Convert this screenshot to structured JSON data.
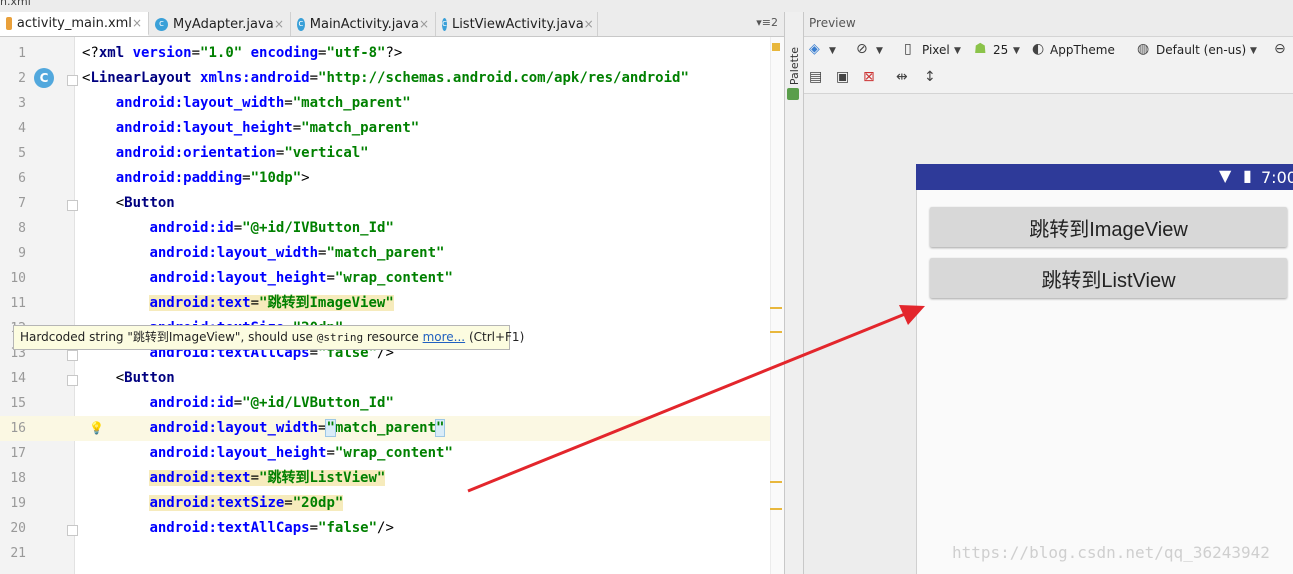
{
  "window": {
    "partial_title": "n.xml"
  },
  "tabs": [
    {
      "label": "activity_main.xml",
      "icon": "xml-file-icon",
      "active": true
    },
    {
      "label": "MyAdapter.java",
      "icon": "java-class-icon",
      "active": false
    },
    {
      "label": "MainActivity.java",
      "icon": "java-class-icon",
      "active": false
    },
    {
      "label": "ListViewActivity.java",
      "icon": "java-class-icon",
      "active": false
    }
  ],
  "tabs_overflow": "▾≡2",
  "editor": {
    "lines": [
      {
        "n": "1",
        "text": "<?xml version=\"1.0\" encoding=\"utf-8\"?>"
      },
      {
        "n": "2",
        "text": "<LinearLayout xmlns:android=\"http://schemas.android.com/apk/res/android\""
      },
      {
        "n": "3",
        "text": "    android:layout_width=\"match_parent\""
      },
      {
        "n": "4",
        "text": "    android:layout_height=\"match_parent\""
      },
      {
        "n": "5",
        "text": "    android:orientation=\"vertical\""
      },
      {
        "n": "6",
        "text": "    android:padding=\"10dp\">"
      },
      {
        "n": "7",
        "text": "    <Button"
      },
      {
        "n": "8",
        "text": "        android:id=\"@+id/IVButton_Id\""
      },
      {
        "n": "9",
        "text": "        android:layout_width=\"match_parent\""
      },
      {
        "n": "10",
        "text": "        android:layout_height=\"wrap_content\""
      },
      {
        "n": "11",
        "text": "        android:text=\"跳转到ImageView\""
      },
      {
        "n": "12",
        "text": "        android:textSize=\"20dp\""
      },
      {
        "n": "13",
        "text": "        android:textAllCaps=\"false\"/>"
      },
      {
        "n": "14",
        "text": "    <Button"
      },
      {
        "n": "15",
        "text": "        android:id=\"@+id/LVButton_Id\""
      },
      {
        "n": "16",
        "text": "        android:layout_width=\"match_parent\""
      },
      {
        "n": "17",
        "text": "        android:layout_height=\"wrap_content\""
      },
      {
        "n": "18",
        "text": "        android:text=\"跳转到ListView\""
      },
      {
        "n": "19",
        "text": "        android:textSize=\"20dp\""
      },
      {
        "n": "20",
        "text": "        android:textAllCaps=\"false\"/>"
      },
      {
        "n": "21",
        "text": ""
      }
    ],
    "tooltip": {
      "pre": "Hardcoded string \"跳转到ImageView\", should use ",
      "code": "@string",
      "mid": " resource ",
      "link": "more...",
      "post": " (Ctrl+F1)"
    }
  },
  "preview": {
    "header": "Preview",
    "palette_label": "Palette",
    "toolbar": {
      "device": "Pixel",
      "api": "25",
      "theme": "AppTheme",
      "locale": "Default (en-us)"
    },
    "device_screen": {
      "status_time": "7:00",
      "buttons": [
        "跳转到ImageView",
        "跳转到ListView"
      ]
    }
  },
  "watermark": "https://blog.csdn.net/qq_36243942",
  "colors": {
    "status_bar": "#2e3a99",
    "annotation_arrow": "#e3262c"
  }
}
